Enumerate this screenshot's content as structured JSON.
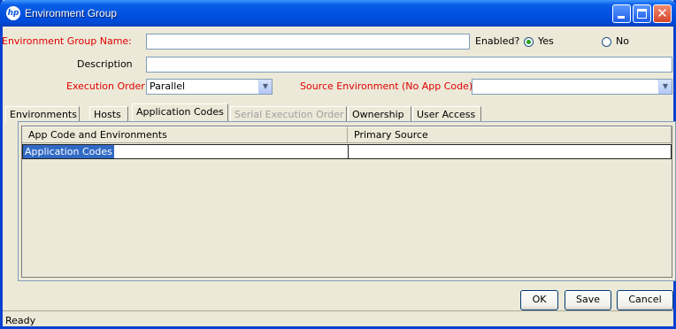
{
  "window": {
    "title": "Environment Group",
    "logo_text": "hp"
  },
  "form": {
    "group_name_label": "Environment Group Name:",
    "group_name_value": "",
    "enabled_label": "Enabled?",
    "enabled_yes_label": "Yes",
    "enabled_no_label": "No",
    "enabled_value": "Yes",
    "description_label": "Description",
    "description_value": "",
    "execution_order_label": "Execution Order",
    "execution_order_value": "Parallel",
    "source_env_label": "Source Environment (No App Code)",
    "source_env_value": ""
  },
  "tabs": [
    {
      "label": "Environments",
      "state": "normal"
    },
    {
      "label": "Hosts",
      "state": "normal"
    },
    {
      "label": "Application Codes",
      "state": "active"
    },
    {
      "label": "Serial Execution Order",
      "state": "disabled"
    },
    {
      "label": "Ownership",
      "state": "normal"
    },
    {
      "label": "User Access",
      "state": "normal"
    }
  ],
  "table": {
    "columns": [
      "App Code and Environments",
      "Primary Source"
    ],
    "rows": [
      [
        "Application Codes",
        ""
      ]
    ]
  },
  "buttons": {
    "ok": "OK",
    "save": "Save",
    "cancel": "Cancel"
  },
  "status": "Ready",
  "colors": {
    "required_label": "#E00000",
    "selection": "#316AC5",
    "titlebar": "#0053E0"
  }
}
